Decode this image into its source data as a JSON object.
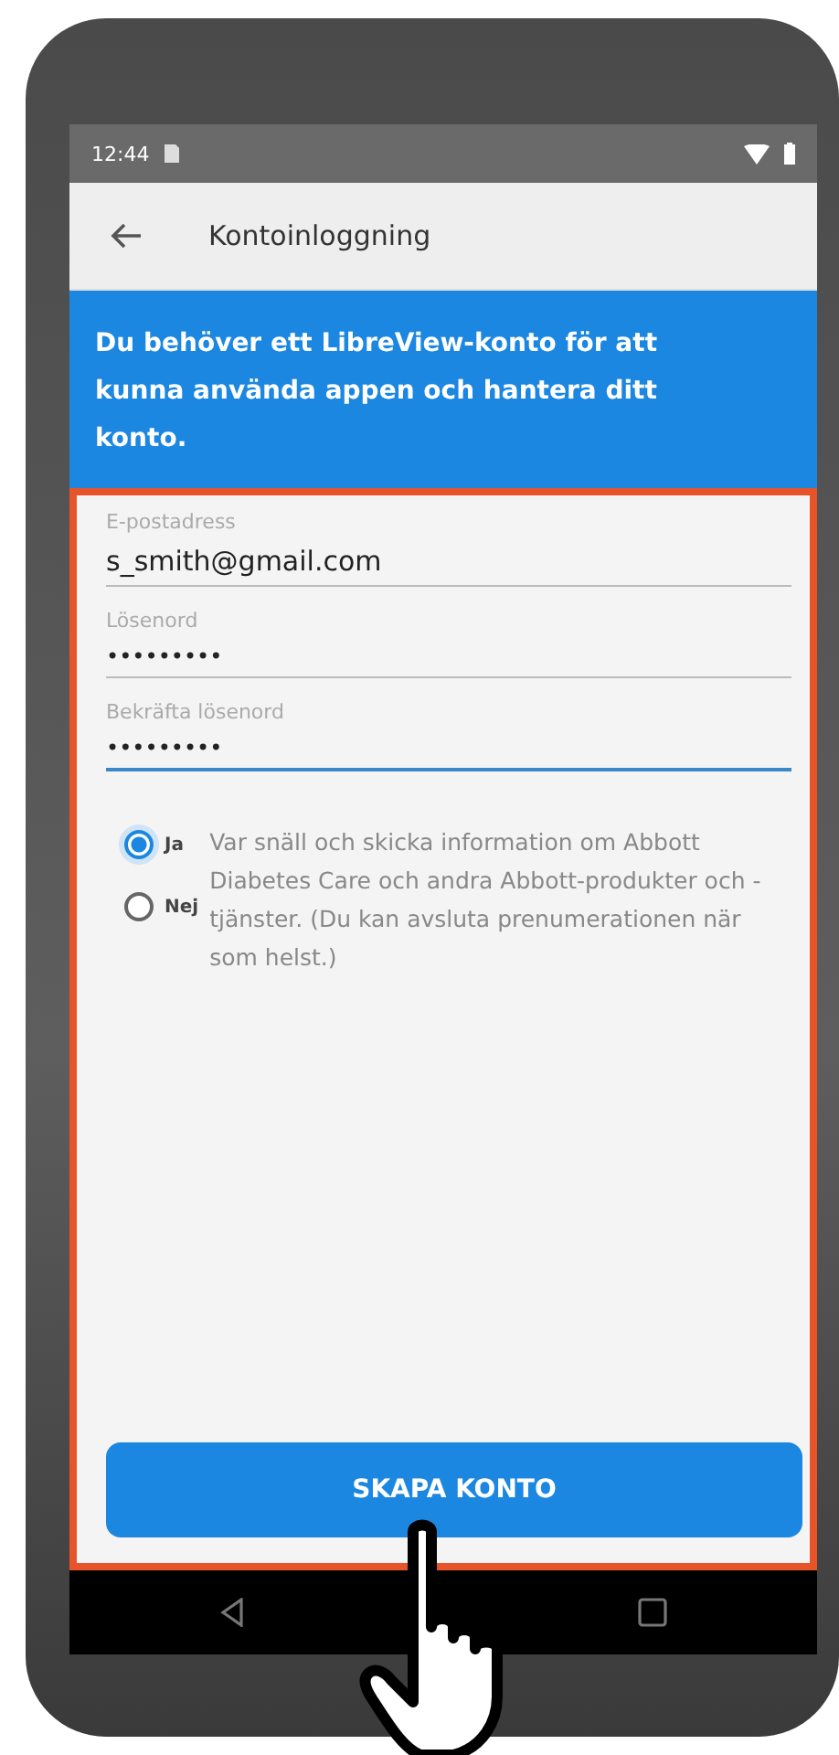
{
  "status_bar": {
    "time": "12:44"
  },
  "app_bar": {
    "title": "Kontoinloggning"
  },
  "banner": {
    "text": "Du behöver ett LibreView-konto för att kunna använda appen och hantera ditt konto."
  },
  "form": {
    "fields": [
      {
        "kind": "email",
        "label": "E-postadress",
        "value": "s_smith@gmail.com",
        "focused": false
      },
      {
        "kind": "password",
        "label": "Lösenord",
        "value": "•••••••••",
        "focused": false
      },
      {
        "kind": "password",
        "label": "Bekräfta lösenord",
        "value": "•••••••••",
        "focused": true
      }
    ],
    "consent": {
      "options": [
        {
          "label": "Ja",
          "selected": true
        },
        {
          "label": "Nej",
          "selected": false
        }
      ],
      "text": "Var snäll och skicka information om Abbott Diabetes Care och andra Abbott-produkter och -tjänster. (Du kan avsluta prenumerationen när som helst.)"
    },
    "submit_button": "SKAPA KONTO"
  }
}
